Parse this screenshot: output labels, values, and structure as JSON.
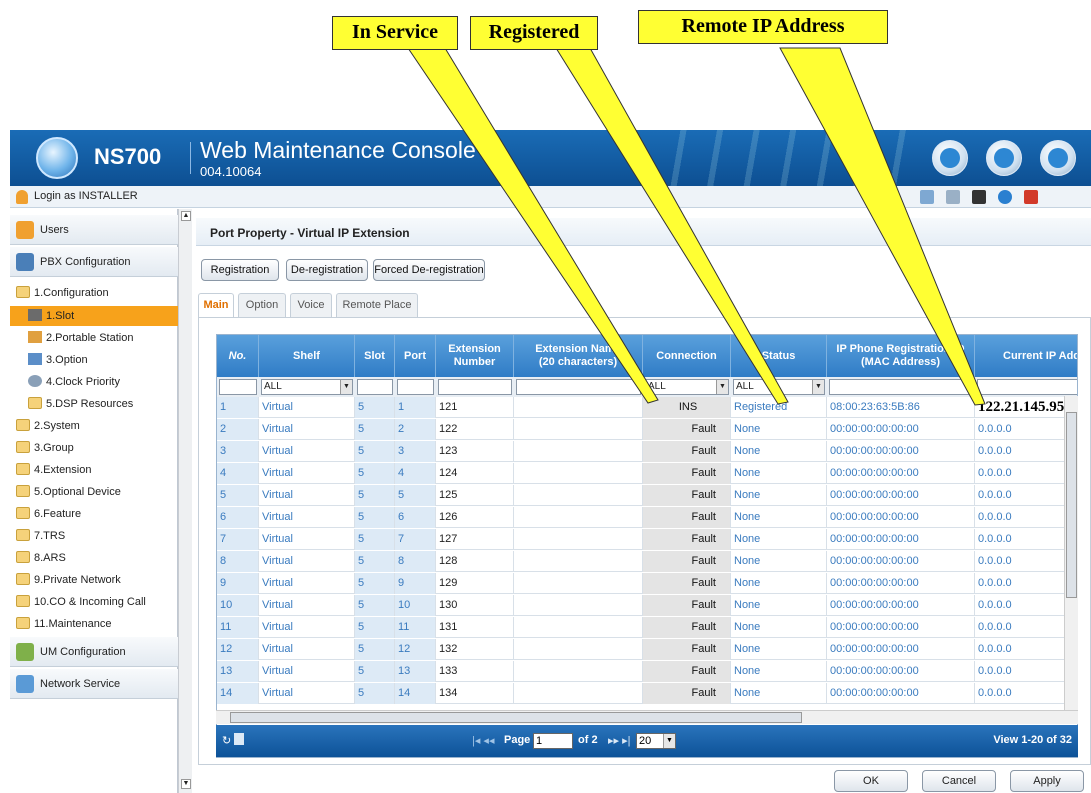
{
  "callouts": {
    "in_service": "In Service",
    "registered": "Registered",
    "remote_ip": "Remote IP Address"
  },
  "header": {
    "brand": "NS700",
    "title": "Web Maintenance Console",
    "version": "004.10064",
    "icons": [
      "home-icon",
      "tool-icon",
      "settings-icon"
    ]
  },
  "login": {
    "text": "Login as INSTALLER",
    "toolbar_icons": [
      "report-icon",
      "contacts-icon",
      "save-icon",
      "info-icon",
      "logout-icon"
    ]
  },
  "sidebar": {
    "panels": {
      "users": "Users",
      "pbx": "PBX Configuration",
      "um": "UM Configuration",
      "network": "Network Service"
    },
    "tree": {
      "configuration": "1.Configuration",
      "slot": "1.Slot",
      "portable": "2.Portable Station",
      "option": "3.Option",
      "clock": "4.Clock Priority",
      "dsp": "5.DSP Resources",
      "system": "2.System",
      "group": "3.Group",
      "extension": "4.Extension",
      "optional": "5.Optional Device",
      "feature": "6.Feature",
      "trs": "7.TRS",
      "ars": "8.ARS",
      "private": "9.Private Network",
      "co": "10.CO & Incoming Call",
      "maint": "11.Maintenance"
    }
  },
  "main": {
    "title": "Port Property - Virtual IP Extension",
    "buttons": {
      "registration": "Registration",
      "deregistration": "De-registration",
      "forced": "Forced De-registration"
    },
    "tabs": {
      "main": "Main",
      "option": "Option",
      "voice": "Voice",
      "remote": "Remote Place"
    }
  },
  "grid": {
    "headers": {
      "no": "No.",
      "shelf": "Shelf",
      "slot": "Slot",
      "port": "Port",
      "ext_num_1": "Extension",
      "ext_num_2": "Number",
      "ext_name_1": "Extension Name",
      "ext_name_2": "(20 characters)",
      "connection": "Connection",
      "status": "Status",
      "mac_1": "IP Phone Registration ID",
      "mac_2": "(MAC Address)",
      "ip": "Current IP Address"
    },
    "filters": {
      "shelf": "ALL",
      "connection": "ALL",
      "status": "ALL"
    },
    "rows": [
      {
        "no": "1",
        "shelf": "Virtual",
        "slot": "5",
        "port": "1",
        "ext": "121",
        "name": "",
        "conn": "INS",
        "status": "Registered",
        "mac": "08:00:23:63:5B:86",
        "ip": "122.21.145.95"
      },
      {
        "no": "2",
        "shelf": "Virtual",
        "slot": "5",
        "port": "2",
        "ext": "122",
        "name": "",
        "conn": "Fault",
        "status": "None",
        "mac": "00:00:00:00:00:00",
        "ip": "0.0.0.0"
      },
      {
        "no": "3",
        "shelf": "Virtual",
        "slot": "5",
        "port": "3",
        "ext": "123",
        "name": "",
        "conn": "Fault",
        "status": "None",
        "mac": "00:00:00:00:00:00",
        "ip": "0.0.0.0"
      },
      {
        "no": "4",
        "shelf": "Virtual",
        "slot": "5",
        "port": "4",
        "ext": "124",
        "name": "",
        "conn": "Fault",
        "status": "None",
        "mac": "00:00:00:00:00:00",
        "ip": "0.0.0.0"
      },
      {
        "no": "5",
        "shelf": "Virtual",
        "slot": "5",
        "port": "5",
        "ext": "125",
        "name": "",
        "conn": "Fault",
        "status": "None",
        "mac": "00:00:00:00:00:00",
        "ip": "0.0.0.0"
      },
      {
        "no": "6",
        "shelf": "Virtual",
        "slot": "5",
        "port": "6",
        "ext": "126",
        "name": "",
        "conn": "Fault",
        "status": "None",
        "mac": "00:00:00:00:00:00",
        "ip": "0.0.0.0"
      },
      {
        "no": "7",
        "shelf": "Virtual",
        "slot": "5",
        "port": "7",
        "ext": "127",
        "name": "",
        "conn": "Fault",
        "status": "None",
        "mac": "00:00:00:00:00:00",
        "ip": "0.0.0.0"
      },
      {
        "no": "8",
        "shelf": "Virtual",
        "slot": "5",
        "port": "8",
        "ext": "128",
        "name": "",
        "conn": "Fault",
        "status": "None",
        "mac": "00:00:00:00:00:00",
        "ip": "0.0.0.0"
      },
      {
        "no": "9",
        "shelf": "Virtual",
        "slot": "5",
        "port": "9",
        "ext": "129",
        "name": "",
        "conn": "Fault",
        "status": "None",
        "mac": "00:00:00:00:00:00",
        "ip": "0.0.0.0"
      },
      {
        "no": "10",
        "shelf": "Virtual",
        "slot": "5",
        "port": "10",
        "ext": "130",
        "name": "",
        "conn": "Fault",
        "status": "None",
        "mac": "00:00:00:00:00:00",
        "ip": "0.0.0.0"
      },
      {
        "no": "11",
        "shelf": "Virtual",
        "slot": "5",
        "port": "11",
        "ext": "131",
        "name": "",
        "conn": "Fault",
        "status": "None",
        "mac": "00:00:00:00:00:00",
        "ip": "0.0.0.0"
      },
      {
        "no": "12",
        "shelf": "Virtual",
        "slot": "5",
        "port": "12",
        "ext": "132",
        "name": "",
        "conn": "Fault",
        "status": "None",
        "mac": "00:00:00:00:00:00",
        "ip": "0.0.0.0"
      },
      {
        "no": "13",
        "shelf": "Virtual",
        "slot": "5",
        "port": "13",
        "ext": "133",
        "name": "",
        "conn": "Fault",
        "status": "None",
        "mac": "00:00:00:00:00:00",
        "ip": "0.0.0.0"
      },
      {
        "no": "14",
        "shelf": "Virtual",
        "slot": "5",
        "port": "14",
        "ext": "134",
        "name": "",
        "conn": "Fault",
        "status": "None",
        "mac": "00:00:00:00:00:00",
        "ip": "0.0.0.0"
      }
    ]
  },
  "pager": {
    "nav_first_prev": "|◂ ◂◂",
    "page_label": "Page",
    "page_value": "1",
    "of_label": "of 2",
    "nav_next_last": "▸▸ ▸|",
    "page_size": "20",
    "view_text": "View 1-20 of 32"
  },
  "footer": {
    "ok": "OK",
    "cancel": "Cancel",
    "apply": "Apply"
  },
  "colors": {
    "callout": "#ffff33",
    "header": "#1a6cb6",
    "selected": "#f7a21b",
    "link": "#3a7bbf"
  }
}
